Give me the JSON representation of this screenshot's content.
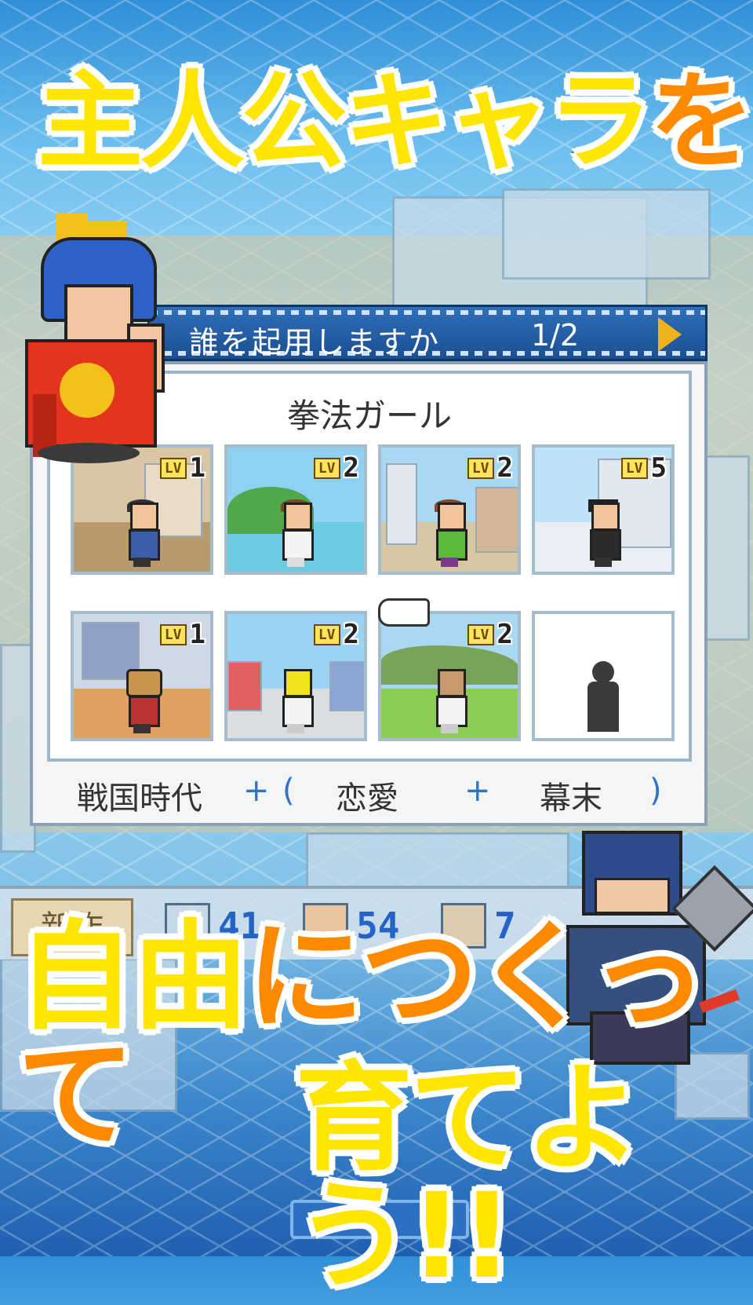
{
  "headline": {
    "line1_main": "主人公キャラ",
    "line1_accent": "を",
    "line2_main": "自由",
    "line2_accent": "につくって",
    "line3": "育てよう!!"
  },
  "dialog": {
    "title": "誰を起用しますか",
    "page": "1/2",
    "genre_name": "拳法ガール",
    "cards": [
      {
        "level_tag": "LV",
        "level": "1"
      },
      {
        "level_tag": "LV",
        "level": "2"
      },
      {
        "level_tag": "LV",
        "level": "2"
      },
      {
        "level_tag": "LV",
        "level": "5"
      },
      {
        "level_tag": "LV",
        "level": "1"
      },
      {
        "level_tag": "LV",
        "level": "2"
      },
      {
        "level_tag": "LV",
        "level": "2"
      },
      {
        "level_tag": "",
        "level": ""
      }
    ],
    "combo": {
      "genre1": "戦国時代",
      "plus1": "+",
      "open": "(",
      "genre2": "恋愛",
      "plus2": "+",
      "genre3": "幕末",
      "close": ")"
    }
  },
  "hud": {
    "new_button": "新作",
    "stat1": "41",
    "stat2": "54",
    "stat3": "7"
  },
  "colors": {
    "headline_yellow": "#ffe600",
    "headline_orange": "#ff8a00",
    "title_bar_blue": "#1b4f93",
    "accent_blue": "#2f73c6"
  }
}
